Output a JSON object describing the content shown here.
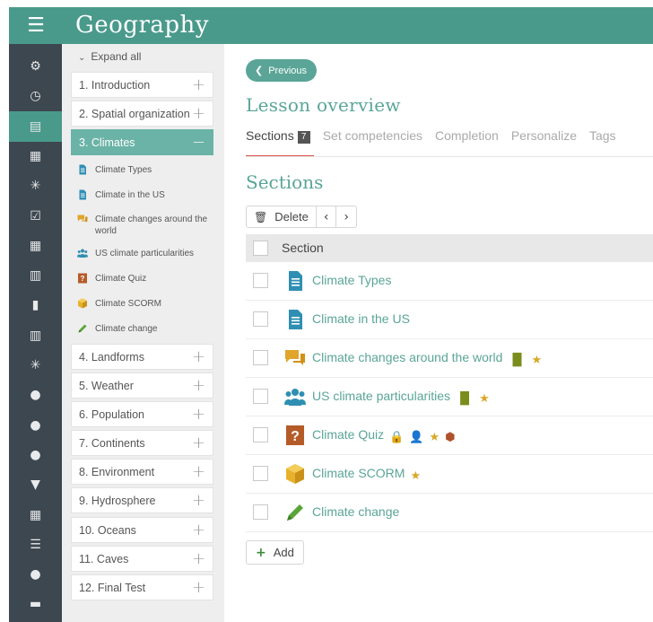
{
  "app": {
    "menu_icon": "hamburger-icon",
    "title": "Geography"
  },
  "rail": {
    "items": [
      {
        "icon": "gear-icon",
        "glyph": "⚙",
        "active": false
      },
      {
        "icon": "clock-icon",
        "glyph": "◷",
        "active": false
      },
      {
        "icon": "book-icon",
        "glyph": "▤",
        "active": true
      },
      {
        "icon": "calendar-icon",
        "glyph": "▦",
        "active": false
      },
      {
        "icon": "asterisk-icon",
        "glyph": "✳",
        "active": false
      },
      {
        "icon": "checkbox-icon",
        "glyph": "☑",
        "active": false
      },
      {
        "icon": "grid-icon",
        "glyph": "▦",
        "active": false
      },
      {
        "icon": "table-icon",
        "glyph": "▥",
        "active": false
      },
      {
        "icon": "bar-chart-icon",
        "glyph": "▮",
        "active": false
      },
      {
        "icon": "columns-icon",
        "glyph": "▥",
        "active": false
      },
      {
        "icon": "asterisk-icon",
        "glyph": "✳",
        "active": false
      },
      {
        "icon": "user-icon",
        "glyph": "●",
        "active": false
      },
      {
        "icon": "user-icon",
        "glyph": "●",
        "active": false
      },
      {
        "icon": "users-icon",
        "glyph": "●",
        "active": false
      },
      {
        "icon": "trophy-icon",
        "glyph": "▼",
        "active": false
      },
      {
        "icon": "grid-icon",
        "glyph": "▦",
        "active": false
      },
      {
        "icon": "list-icon",
        "glyph": "☰",
        "active": false
      },
      {
        "icon": "group-icon",
        "glyph": "●",
        "active": false
      },
      {
        "icon": "chat-icon",
        "glyph": "▬",
        "active": false
      }
    ]
  },
  "outline": {
    "expand_all": "Expand all",
    "chapters": [
      {
        "label": "1. Introduction",
        "toggle": "+"
      },
      {
        "label": "2. Spatial organization",
        "toggle": "+"
      },
      {
        "label": "3. Climates",
        "toggle": "−",
        "active": true
      },
      {
        "label": "4. Landforms",
        "toggle": "+"
      },
      {
        "label": "5. Weather",
        "toggle": "+"
      },
      {
        "label": "6. Population",
        "toggle": "+"
      },
      {
        "label": "7. Continents",
        "toggle": "+"
      },
      {
        "label": "8. Environment",
        "toggle": "+"
      },
      {
        "label": "9. Hydrosphere",
        "toggle": "+"
      },
      {
        "label": "10. Oceans",
        "toggle": "+"
      },
      {
        "label": "11. Caves",
        "toggle": "+"
      },
      {
        "label": "12. Final Test",
        "toggle": "+"
      }
    ],
    "sub_items": [
      {
        "label": "Climate Types",
        "icon": "document-icon"
      },
      {
        "label": "Climate in the US",
        "icon": "document-icon"
      },
      {
        "label": "Climate changes around the world",
        "icon": "discussion-icon"
      },
      {
        "label": "US climate particularities",
        "icon": "group-icon"
      },
      {
        "label": "Climate Quiz",
        "icon": "quiz-icon"
      },
      {
        "label": "Climate SCORM",
        "icon": "package-icon"
      },
      {
        "label": "Climate change",
        "icon": "pencil-icon"
      }
    ],
    "collapse_glyph": "‹"
  },
  "main": {
    "previous": "Previous",
    "lesson_title": "Lesson overview",
    "tabs": [
      {
        "label": "Sections",
        "badge": "7",
        "active": true
      },
      {
        "label": "Set competencies"
      },
      {
        "label": "Completion"
      },
      {
        "label": "Personalize"
      },
      {
        "label": "Tags"
      }
    ],
    "sections_title": "Sections",
    "toolbar": {
      "delete": "Delete",
      "prev_arrow": "‹",
      "next_arrow": "›"
    },
    "table": {
      "header": "Section",
      "rows": [
        {
          "label": "Climate Types",
          "icon": "document-icon"
        },
        {
          "label": "Climate in the US",
          "icon": "document-icon"
        },
        {
          "label": "Climate changes around the world",
          "icon": "discussion-icon",
          "meta": [
            "stats-icon",
            "star-icon"
          ]
        },
        {
          "label": "US climate particularities",
          "icon": "group-icon",
          "meta": [
            "stats-icon",
            "star-icon"
          ]
        },
        {
          "label": "Climate Quiz",
          "icon": "quiz-icon",
          "meta": [
            "lock-icon",
            "user-icon",
            "star-icon",
            "shield-icon"
          ]
        },
        {
          "label": "Climate SCORM",
          "icon": "package-icon",
          "meta": [
            "star-icon"
          ]
        },
        {
          "label": "Climate change",
          "icon": "pencil-icon"
        }
      ]
    },
    "add": "Add"
  },
  "colors": {
    "brand": "#4a9a8c",
    "accent_text": "#5aa597",
    "rail": "#3d4750",
    "active_tab_underline": "#d9534f"
  }
}
